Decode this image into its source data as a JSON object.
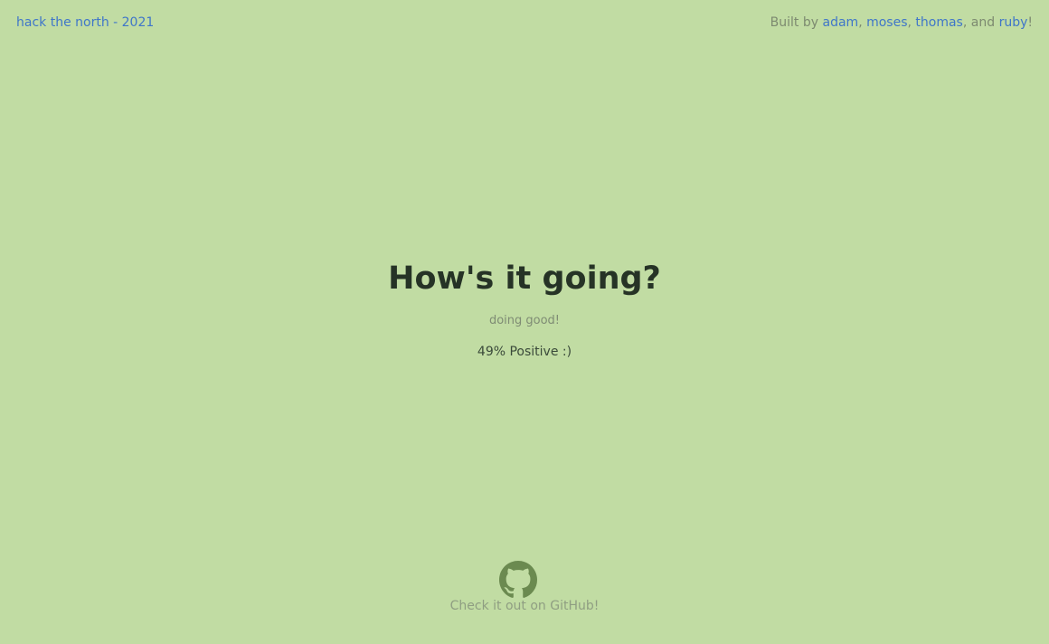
{
  "header": {
    "brand": "hack the north - 2021",
    "credits": {
      "prefix": "Built by ",
      "authors": [
        "adam",
        "moses",
        "thomas",
        "ruby"
      ],
      "sep1": ", ",
      "sep2": ", ",
      "sep3": ", and ",
      "suffix": "!"
    }
  },
  "main": {
    "prompt": "How's it going?",
    "response": "doing good!",
    "sentiment": "49% Positive :)"
  },
  "footer": {
    "icon": "github-icon",
    "link_text": "Check it out on GitHub!"
  },
  "colors": {
    "background": "#c1dca3",
    "link": "#3f76c9",
    "heading": "#263326",
    "github_icon": "#6b8a50"
  }
}
